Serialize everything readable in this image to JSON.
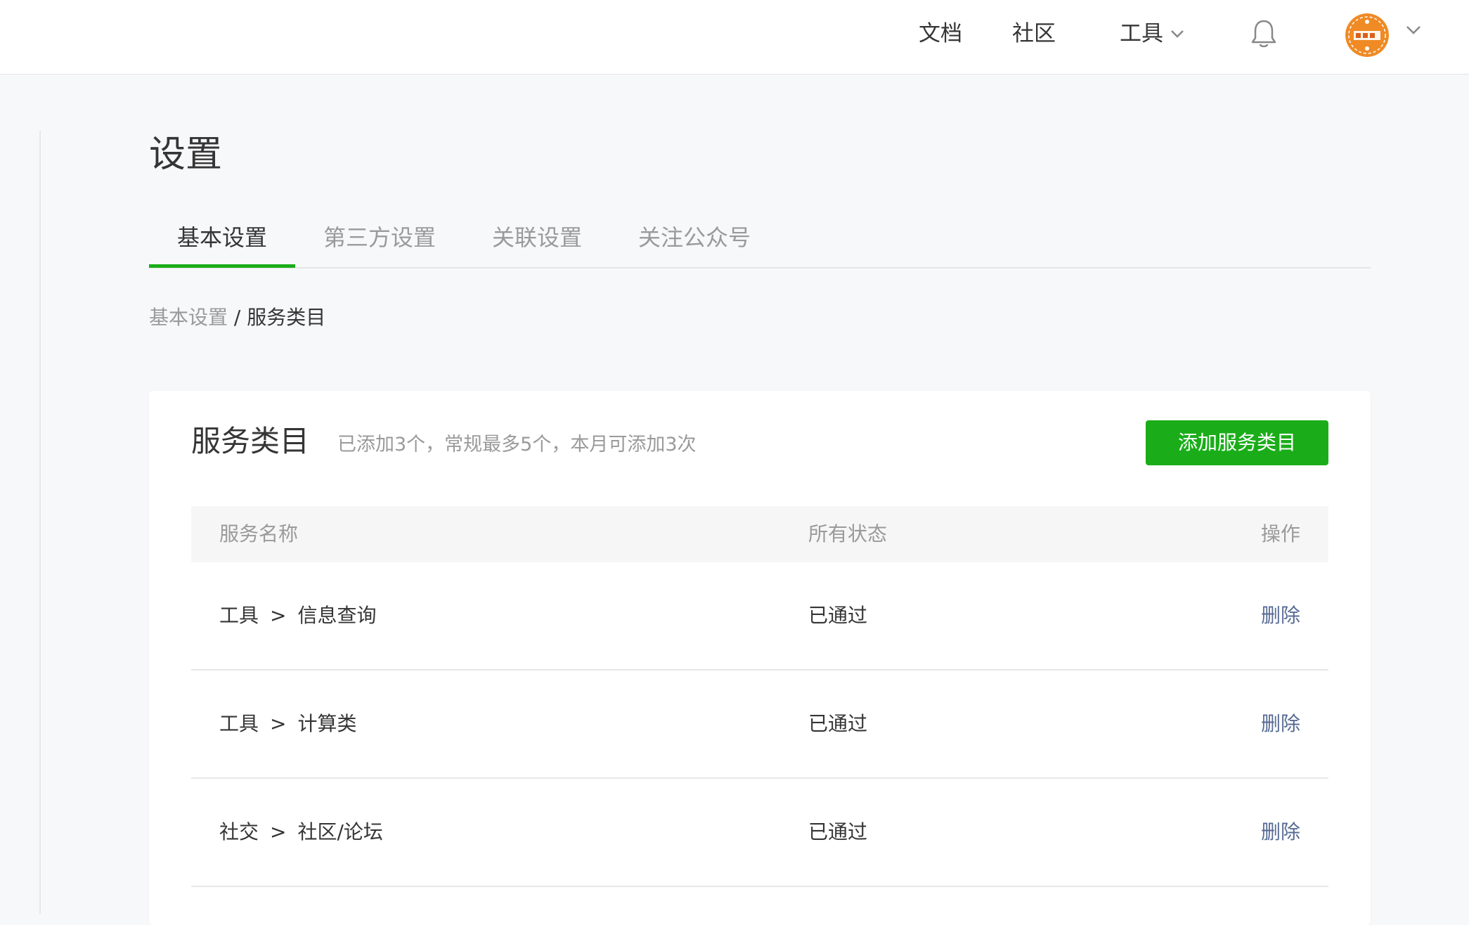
{
  "header": {
    "nav": {
      "docs": "文档",
      "community": "社区",
      "tools": "工具"
    }
  },
  "page": {
    "title": "设置"
  },
  "tabs": [
    {
      "label": "基本设置",
      "active": true
    },
    {
      "label": "第三方设置",
      "active": false
    },
    {
      "label": "关联设置",
      "active": false
    },
    {
      "label": "关注公众号",
      "active": false
    }
  ],
  "breadcrumb": {
    "parent": "基本设置",
    "separator": " / ",
    "current": "服务类目"
  },
  "card": {
    "title": "服务类目",
    "description": "已添加3个，常规最多5个，本月可添加3次",
    "add_button": "添加服务类目"
  },
  "table": {
    "headers": {
      "name": "服务名称",
      "status": "所有状态",
      "operation": "操作"
    },
    "arrow": ">",
    "rows": [
      {
        "category": "工具",
        "subcategory": "信息查询",
        "status": "已通过",
        "action": "删除"
      },
      {
        "category": "工具",
        "subcategory": "计算类",
        "status": "已通过",
        "action": "删除"
      },
      {
        "category": "社交",
        "subcategory": "社区/论坛",
        "status": "已通过",
        "action": "删除"
      }
    ]
  },
  "colors": {
    "accent": "#1aad19",
    "link": "#576b95",
    "avatar": "#f08a24"
  }
}
